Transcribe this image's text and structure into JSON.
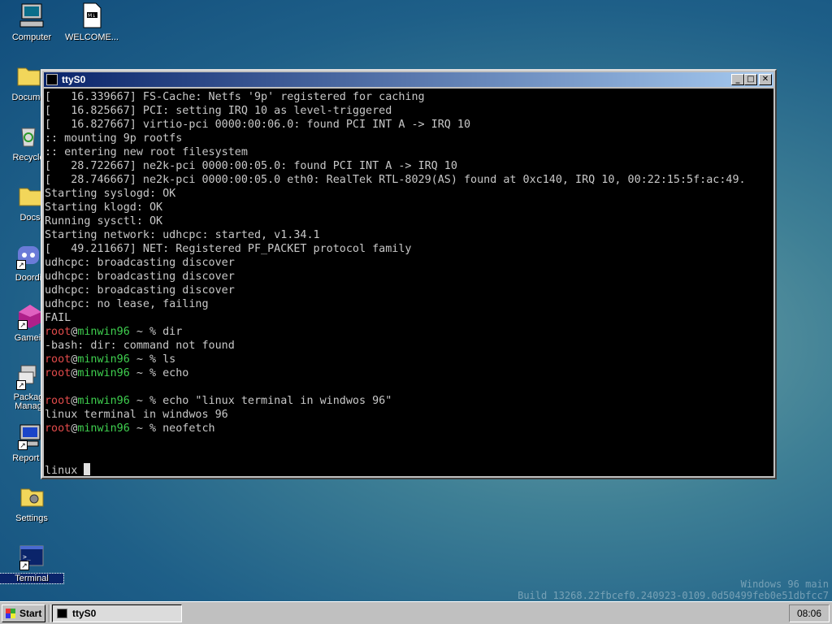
{
  "desktop": {
    "icons": [
      {
        "label": "Computer",
        "icon": "computer-icon"
      },
      {
        "label": "WELCOME...",
        "icon": "markdown-file-icon"
      },
      {
        "label": "Docume",
        "icon": "folder-icon"
      },
      {
        "label": "Recycle",
        "icon": "recycle-bin-icon"
      },
      {
        "label": "Docs",
        "icon": "folder-icon"
      },
      {
        "label": "Doordi",
        "icon": "discord-icon"
      },
      {
        "label": "Gamein",
        "icon": "gamepad-icon"
      },
      {
        "label": "Packag\nManag",
        "icon": "package-manager-icon"
      },
      {
        "label": "Report B",
        "icon": "report-icon"
      },
      {
        "label": "Settings",
        "icon": "settings-icon"
      },
      {
        "label": "Terminal",
        "icon": "terminal-icon"
      }
    ],
    "watermark": {
      "line1": "Windows 96 main",
      "line2": "Build 13268.22fbcef0.240923-0109.0d50499feb0e51dbfcc7"
    }
  },
  "window": {
    "title": "ttyS0",
    "buttons": {
      "minimize": "_",
      "maximize": "□",
      "close": "✕"
    }
  },
  "terminal": {
    "prompt": {
      "user": "root",
      "at": "@",
      "host": "minwin96",
      "path": " ~ % "
    },
    "lines": [
      {
        "text": "[   16.339667] FS-Cache: Netfs '9p' registered for caching"
      },
      {
        "text": "[   16.825667] PCI: setting IRQ 10 as level-triggered"
      },
      {
        "text": "[   16.827667] virtio-pci 0000:00:06.0: found PCI INT A -> IRQ 10"
      },
      {
        "text": ":: mounting 9p rootfs"
      },
      {
        "text": ":: entering new root filesystem"
      },
      {
        "text": "[   28.722667] ne2k-pci 0000:00:05.0: found PCI INT A -> IRQ 10"
      },
      {
        "text": "[   28.746667] ne2k-pci 0000:00:05.0 eth0: RealTek RTL-8029(AS) found at 0xc140, IRQ 10, 00:22:15:5f:ac:49."
      },
      {
        "text": "Starting syslogd: OK"
      },
      {
        "text": "Starting klogd: OK"
      },
      {
        "text": "Running sysctl: OK"
      },
      {
        "text": "Starting network: udhcpc: started, v1.34.1"
      },
      {
        "text": "[   49.211667] NET: Registered PF_PACKET protocol family"
      },
      {
        "text": "udhcpc: broadcasting discover"
      },
      {
        "text": "udhcpc: broadcasting discover"
      },
      {
        "text": "udhcpc: broadcasting discover"
      },
      {
        "text": "udhcpc: no lease, failing"
      },
      {
        "text": "FAIL"
      },
      {
        "cmd": "dir"
      },
      {
        "text": "-bash: dir: command not found"
      },
      {
        "cmd": "ls"
      },
      {
        "cmd": "echo"
      },
      {
        "text": ""
      },
      {
        "cmd": "echo \"linux terminal in windwos 96\""
      },
      {
        "text": "linux terminal in windwos 96"
      },
      {
        "cmd": "neofetch"
      },
      {
        "text": ""
      },
      {
        "text": ""
      }
    ],
    "input": "linux "
  },
  "taskbar": {
    "start_label": "Start",
    "tasks": [
      {
        "label": "ttyS0"
      }
    ],
    "clock": "08:06"
  }
}
